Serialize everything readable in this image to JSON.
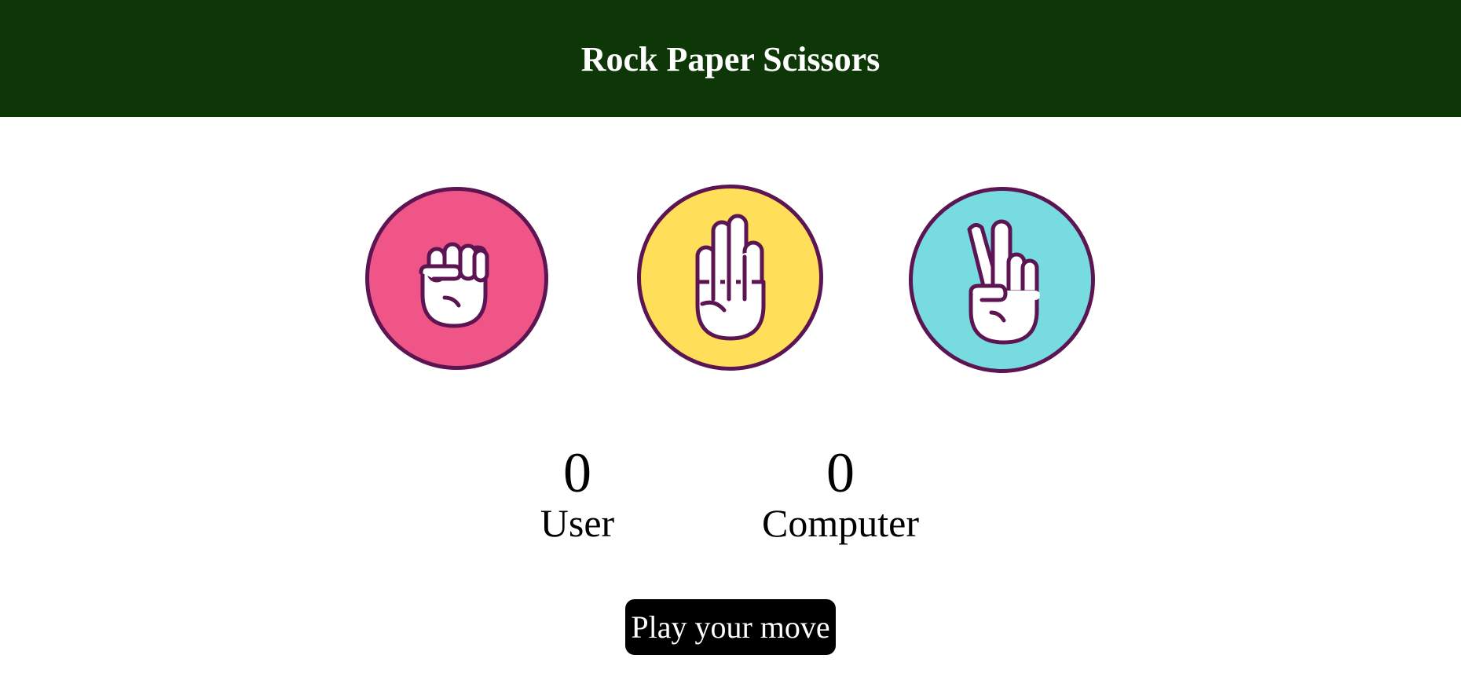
{
  "header": {
    "title": "Rock Paper Scissors"
  },
  "choices": [
    {
      "id": "rock",
      "icon": "rock-fist-icon",
      "color": "#ef5586"
    },
    {
      "id": "paper",
      "icon": "paper-hand-icon",
      "color": "#ffde59"
    },
    {
      "id": "scissors",
      "icon": "scissors-hand-icon",
      "color": "#77dbe0"
    }
  ],
  "scoreboard": {
    "user": {
      "score": "0",
      "label": "User"
    },
    "computer": {
      "score": "0",
      "label": "Computer"
    }
  },
  "message": {
    "text": "Play your move"
  },
  "colors": {
    "header_bg": "#0e3708",
    "outline": "#5d1452",
    "message_bg": "#000000"
  }
}
